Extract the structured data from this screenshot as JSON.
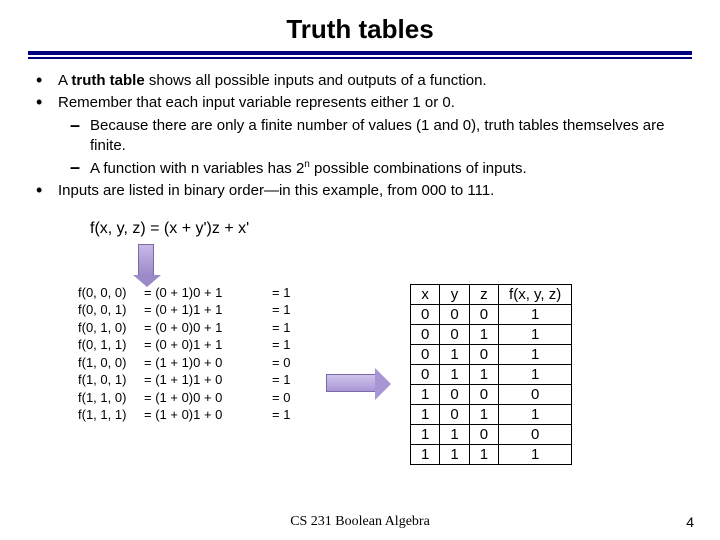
{
  "title": "Truth tables",
  "bullets": {
    "b1_pre": "A ",
    "b1_strong": "truth table",
    "b1_post": " shows all possible inputs and outputs of a function.",
    "b2": "Remember that each input variable represents either 1 or 0.",
    "b2a": "Because there are only a finite number of values (1 and 0), truth tables themselves are finite.",
    "b2b_pre": "A function with n variables has 2",
    "b2b_sup": "n",
    "b2b_post": " possible combinations of inputs.",
    "b3": "Inputs are listed in binary order—in this example, from 000 to 111."
  },
  "formula": "f(x, y, z) = (x + y')z + x'",
  "evals": [
    {
      "c1": "f(0, 0, 0)",
      "c2": "= (0 + 1)0 + 1",
      "c3": "= 1"
    },
    {
      "c1": "f(0, 0, 1)",
      "c2": "= (0 + 1)1 + 1",
      "c3": "= 1"
    },
    {
      "c1": "f(0, 1, 0)",
      "c2": "= (0 + 0)0 + 1",
      "c3": "= 1"
    },
    {
      "c1": "f(0, 1, 1)",
      "c2": "= (0 + 0)1 + 1",
      "c3": "= 1"
    },
    {
      "c1": "f(1, 0, 0)",
      "c2": "= (1 + 1)0 + 0",
      "c3": "= 0"
    },
    {
      "c1": "f(1, 0, 1)",
      "c2": "= (1 + 1)1 + 0",
      "c3": "= 1"
    },
    {
      "c1": "f(1, 1, 0)",
      "c2": "= (1 + 0)0 + 0",
      "c3": "= 0"
    },
    {
      "c1": "f(1, 1, 1)",
      "c2": "= (1 + 0)1 + 0",
      "c3": "= 1"
    }
  ],
  "table": {
    "headers": [
      "x",
      "y",
      "z",
      "f(x, y, z)"
    ],
    "rows": [
      [
        "0",
        "0",
        "0",
        "1"
      ],
      [
        "0",
        "0",
        "1",
        "1"
      ],
      [
        "0",
        "1",
        "0",
        "1"
      ],
      [
        "0",
        "1",
        "1",
        "1"
      ],
      [
        "1",
        "0",
        "0",
        "0"
      ],
      [
        "1",
        "0",
        "1",
        "1"
      ],
      [
        "1",
        "1",
        "0",
        "0"
      ],
      [
        "1",
        "1",
        "1",
        "1"
      ]
    ]
  },
  "footer": "CS 231 Boolean Algebra",
  "page": "4",
  "chart_data": {
    "type": "table",
    "title": "Truth table for f(x, y, z) = (x + y')z + x'",
    "columns": [
      "x",
      "y",
      "z",
      "f(x, y, z)"
    ],
    "rows": [
      [
        0,
        0,
        0,
        1
      ],
      [
        0,
        0,
        1,
        1
      ],
      [
        0,
        1,
        0,
        1
      ],
      [
        0,
        1,
        1,
        1
      ],
      [
        1,
        0,
        0,
        0
      ],
      [
        1,
        0,
        1,
        1
      ],
      [
        1,
        1,
        0,
        0
      ],
      [
        1,
        1,
        1,
        1
      ]
    ]
  }
}
